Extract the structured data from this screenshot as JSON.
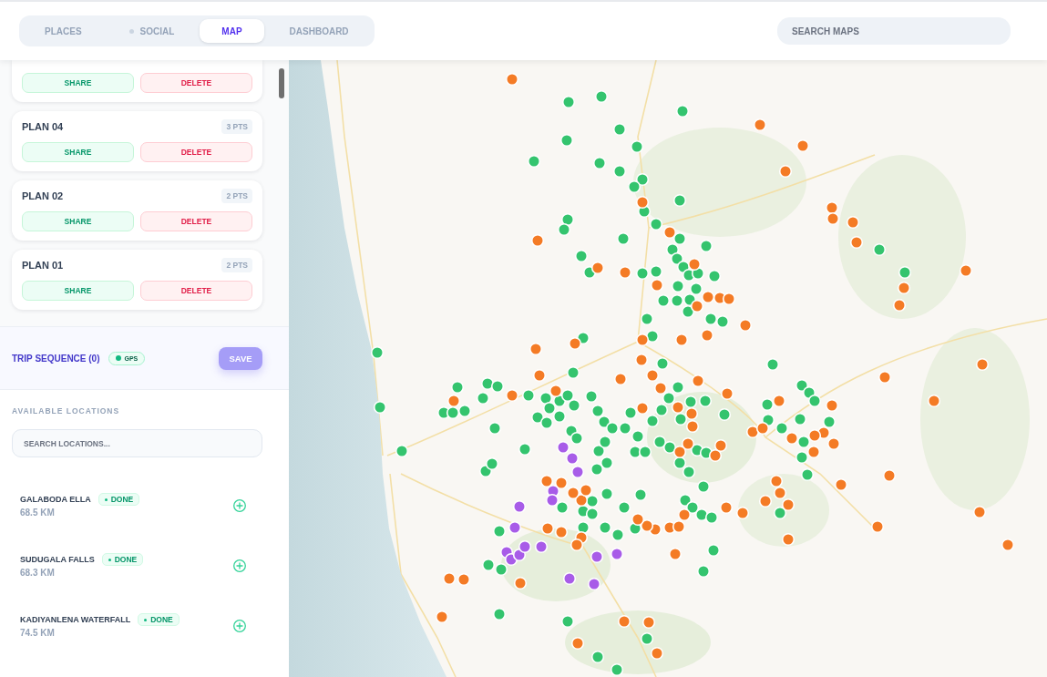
{
  "header": {
    "tabs": [
      {
        "label": "PLACES",
        "selected": false,
        "status_dot": false
      },
      {
        "label": "SOCIAL",
        "selected": false,
        "status_dot": true
      },
      {
        "label": "MAP",
        "selected": true,
        "status_dot": false
      },
      {
        "label": "DASHBOARD",
        "selected": false,
        "status_dot": false
      }
    ],
    "search": {
      "placeholder": "SEARCH MAPS"
    }
  },
  "sidebar": {
    "plans": [
      {
        "share": "SHARE",
        "delete": "DELETE"
      },
      {
        "title": "PLAN 04",
        "points": "3 PTS",
        "share": "SHARE",
        "delete": "DELETE"
      },
      {
        "title": "PLAN 02",
        "points": "2 PTS",
        "share": "SHARE",
        "delete": "DELETE"
      },
      {
        "title": "PLAN 01",
        "points": "2 PTS",
        "share": "SHARE",
        "delete": "DELETE"
      }
    ],
    "trip_sequence": {
      "title": "TRIP SEQUENCE (0)",
      "gps": {
        "label": "GPS",
        "active": true
      },
      "save": {
        "label": "SAVE",
        "disabled": true
      }
    },
    "available_locations": {
      "heading": "AVAILABLE LOCATIONS",
      "search": {
        "placeholder": "SEARCH LOCATIONS..."
      },
      "items": [
        {
          "name": "GALABODA ELLA",
          "status": "DONE",
          "distance": "68.5 KM"
        },
        {
          "name": "SUDUGALA FALLS",
          "status": "DONE",
          "distance": "68.3 KM"
        },
        {
          "name": "KADIYANLENA WATERFALL",
          "status": "DONE",
          "distance": "74.5 KM"
        }
      ]
    }
  },
  "map": {
    "pins": [
      {
        "color": "#34c46e"
      },
      {
        "color": "#34c46e"
      },
      {
        "color": "#34c46e"
      },
      {
        "color": "#34c46e"
      },
      {
        "color": "#34c46e"
      },
      {
        "color": "#34c46e"
      },
      {
        "color": "#34c46e"
      },
      {
        "color": "#34c46e"
      },
      {
        "color": "#34c46e"
      },
      {
        "color": "#34c46e"
      },
      {
        "color": "#34c46e"
      },
      {
        "color": "#34c46e"
      },
      {
        "color": "#34c46e"
      },
      {
        "color": "#34c46e"
      },
      {
        "color": "#34c46e"
      },
      {
        "color": "#34c46e"
      },
      {
        "color": "#34c46e"
      },
      {
        "color": "#34c46e"
      },
      {
        "color": "#34c46e"
      },
      {
        "color": "#34c46e"
      },
      {
        "color": "#34c46e"
      },
      {
        "color": "#34c46e"
      },
      {
        "color": "#34c46e"
      },
      {
        "color": "#34c46e"
      },
      {
        "color": "#34c46e"
      },
      {
        "color": "#34c46e"
      },
      {
        "color": "#34c46e"
      },
      {
        "color": "#34c46e"
      },
      {
        "color": "#34c46e"
      },
      {
        "color": "#34c46e"
      },
      {
        "color": "#34c46e"
      },
      {
        "color": "#34c46e"
      },
      {
        "color": "#34c46e"
      },
      {
        "color": "#34c46e"
      },
      {
        "color": "#34c46e"
      },
      {
        "color": "#34c46e"
      },
      {
        "color": "#34c46e"
      },
      {
        "color": "#34c46e"
      },
      {
        "color": "#34c46e"
      },
      {
        "color": "#34c46e"
      },
      {
        "color": "#34c46e"
      },
      {
        "color": "#34c46e"
      },
      {
        "color": "#34c46e"
      },
      {
        "color": "#34c46e"
      },
      {
        "color": "#34c46e"
      },
      {
        "color": "#34c46e"
      },
      {
        "color": "#34c46e"
      },
      {
        "color": "#34c46e"
      },
      {
        "color": "#34c46e"
      },
      {
        "color": "#34c46e"
      },
      {
        "color": "#34c46e"
      },
      {
        "color": "#34c46e"
      },
      {
        "color": "#34c46e"
      },
      {
        "color": "#34c46e"
      },
      {
        "color": "#34c46e"
      },
      {
        "color": "#34c46e"
      },
      {
        "color": "#34c46e"
      },
      {
        "color": "#34c46e"
      },
      {
        "color": "#34c46e"
      },
      {
        "color": "#34c46e"
      },
      {
        "color": "#34c46e"
      },
      {
        "color": "#34c46e"
      },
      {
        "color": "#34c46e"
      },
      {
        "color": "#34c46e"
      },
      {
        "color": "#34c46e"
      },
      {
        "color": "#34c46e"
      },
      {
        "color": "#34c46e"
      },
      {
        "color": "#34c46e"
      },
      {
        "color": "#34c46e"
      },
      {
        "color": "#34c46e"
      },
      {
        "color": "#34c46e"
      },
      {
        "color": "#34c46e"
      },
      {
        "color": "#34c46e"
      },
      {
        "color": "#34c46e"
      },
      {
        "color": "#34c46e"
      },
      {
        "color": "#34c46e"
      },
      {
        "color": "#34c46e"
      },
      {
        "color": "#34c46e"
      },
      {
        "color": "#34c46e"
      },
      {
        "color": "#34c46e"
      },
      {
        "color": "#34c46e"
      },
      {
        "color": "#34c46e"
      },
      {
        "color": "#34c46e"
      },
      {
        "color": "#34c46e"
      },
      {
        "color": "#34c46e"
      },
      {
        "color": "#34c46e"
      },
      {
        "color": "#34c46e"
      },
      {
        "color": "#34c46e"
      },
      {
        "color": "#34c46e"
      },
      {
        "color": "#34c46e"
      },
      {
        "color": "#34c46e"
      },
      {
        "color": "#34c46e"
      },
      {
        "color": "#34c46e"
      },
      {
        "color": "#34c46e"
      },
      {
        "color": "#34c46e"
      },
      {
        "color": "#34c46e"
      },
      {
        "color": "#34c46e"
      },
      {
        "color": "#34c46e"
      },
      {
        "color": "#34c46e"
      },
      {
        "color": "#34c46e"
      },
      {
        "color": "#34c46e"
      },
      {
        "color": "#34c46e"
      },
      {
        "color": "#34c46e"
      },
      {
        "color": "#34c46e"
      },
      {
        "color": "#34c46e"
      },
      {
        "color": "#34c46e"
      },
      {
        "color": "#34c46e"
      },
      {
        "color": "#34c46e"
      },
      {
        "color": "#34c46e"
      },
      {
        "color": "#34c46e"
      },
      {
        "color": "#34c46e"
      },
      {
        "color": "#34c46e"
      },
      {
        "color": "#34c46e"
      },
      {
        "color": "#34c46e"
      },
      {
        "color": "#34c46e"
      },
      {
        "color": "#34c46e"
      },
      {
        "color": "#34c46e"
      },
      {
        "color": "#34c46e"
      },
      {
        "color": "#34c46e"
      },
      {
        "color": "#34c46e"
      },
      {
        "color": "#34c46e"
      },
      {
        "color": "#34c46e"
      },
      {
        "color": "#34c46e"
      },
      {
        "color": "#34c46e"
      },
      {
        "color": "#34c46e"
      },
      {
        "color": "#34c46e"
      },
      {
        "color": "#34c46e"
      },
      {
        "color": "#34c46e"
      },
      {
        "color": "#34c46e"
      },
      {
        "color": "#34c46e"
      },
      {
        "color": "#34c46e"
      },
      {
        "color": "#34c46e"
      },
      {
        "color": "#34c46e"
      },
      {
        "color": "#34c46e"
      },
      {
        "color": "#34c46e"
      },
      {
        "color": "#f47b25"
      },
      {
        "color": "#f47b25"
      },
      {
        "color": "#f47b25"
      },
      {
        "color": "#f47b25"
      },
      {
        "color": "#f47b25"
      },
      {
        "color": "#f47b25"
      },
      {
        "color": "#f47b25"
      },
      {
        "color": "#f47b25"
      },
      {
        "color": "#f47b25"
      },
      {
        "color": "#f47b25"
      },
      {
        "color": "#f47b25"
      },
      {
        "color": "#f47b25"
      },
      {
        "color": "#f47b25"
      },
      {
        "color": "#f47b25"
      },
      {
        "color": "#f47b25"
      },
      {
        "color": "#f47b25"
      },
      {
        "color": "#f47b25"
      },
      {
        "color": "#f47b25"
      },
      {
        "color": "#f47b25"
      },
      {
        "color": "#f47b25"
      },
      {
        "color": "#f47b25"
      },
      {
        "color": "#f47b25"
      },
      {
        "color": "#f47b25"
      },
      {
        "color": "#f47b25"
      },
      {
        "color": "#f47b25"
      },
      {
        "color": "#f47b25"
      },
      {
        "color": "#f47b25"
      },
      {
        "color": "#f47b25"
      },
      {
        "color": "#f47b25"
      },
      {
        "color": "#f47b25"
      },
      {
        "color": "#f47b25"
      },
      {
        "color": "#f47b25"
      },
      {
        "color": "#f47b25"
      },
      {
        "color": "#f47b25"
      },
      {
        "color": "#f47b25"
      },
      {
        "color": "#f47b25"
      },
      {
        "color": "#f47b25"
      },
      {
        "color": "#f47b25"
      },
      {
        "color": "#f47b25"
      },
      {
        "color": "#f47b25"
      },
      {
        "color": "#f47b25"
      },
      {
        "color": "#f47b25"
      },
      {
        "color": "#f47b25"
      },
      {
        "color": "#f47b25"
      },
      {
        "color": "#f47b25"
      },
      {
        "color": "#f47b25"
      },
      {
        "color": "#f47b25"
      },
      {
        "color": "#f47b25"
      },
      {
        "color": "#f47b25"
      },
      {
        "color": "#f47b25"
      },
      {
        "color": "#f47b25"
      },
      {
        "color": "#f47b25"
      },
      {
        "color": "#f47b25"
      },
      {
        "color": "#f47b25"
      },
      {
        "color": "#f47b25"
      },
      {
        "color": "#f47b25"
      },
      {
        "color": "#f47b25"
      },
      {
        "color": "#f47b25"
      },
      {
        "color": "#f47b25"
      },
      {
        "color": "#f47b25"
      },
      {
        "color": "#f47b25"
      },
      {
        "color": "#f47b25"
      },
      {
        "color": "#f47b25"
      },
      {
        "color": "#f47b25"
      },
      {
        "color": "#f47b25"
      },
      {
        "color": "#f47b25"
      },
      {
        "color": "#f47b25"
      },
      {
        "color": "#f47b25"
      },
      {
        "color": "#f47b25"
      },
      {
        "color": "#f47b25"
      },
      {
        "color": "#f47b25"
      },
      {
        "color": "#f47b25"
      },
      {
        "color": "#f47b25"
      },
      {
        "color": "#f47b25"
      },
      {
        "color": "#f47b25"
      },
      {
        "color": "#f47b25"
      },
      {
        "color": "#f47b25"
      },
      {
        "color": "#f47b25"
      },
      {
        "color": "#f47b25"
      },
      {
        "color": "#f47b25"
      },
      {
        "color": "#f47b25"
      },
      {
        "color": "#f47b25"
      },
      {
        "color": "#f47b25"
      },
      {
        "color": "#f47b25"
      },
      {
        "color": "#f47b25"
      },
      {
        "color": "#f47b25"
      },
      {
        "color": "#f47b25"
      },
      {
        "color": "#f47b25"
      },
      {
        "color": "#f47b25"
      },
      {
        "color": "#f47b25"
      },
      {
        "color": "#f47b25"
      },
      {
        "color": "#f47b25"
      },
      {
        "color": "#f47b25"
      },
      {
        "color": "#f47b25"
      },
      {
        "color": "#a85ce8"
      },
      {
        "color": "#a85ce8"
      },
      {
        "color": "#a85ce8"
      },
      {
        "color": "#a85ce8"
      },
      {
        "color": "#a85ce8"
      },
      {
        "color": "#a85ce8"
      },
      {
        "color": "#a85ce8"
      },
      {
        "color": "#a85ce8"
      },
      {
        "color": "#a85ce8"
      },
      {
        "color": "#a85ce8"
      },
      {
        "color": "#a85ce8"
      },
      {
        "color": "#a85ce8"
      },
      {
        "color": "#a85ce8"
      },
      {
        "color": "#a85ce8"
      },
      {
        "color": "#a85ce8"
      },
      {
        "color": "#a85ce8"
      }
    ]
  }
}
